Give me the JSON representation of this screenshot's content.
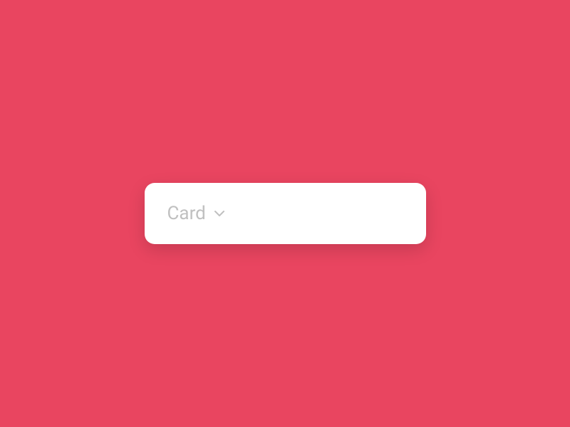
{
  "dropdown": {
    "label": "Card"
  }
}
